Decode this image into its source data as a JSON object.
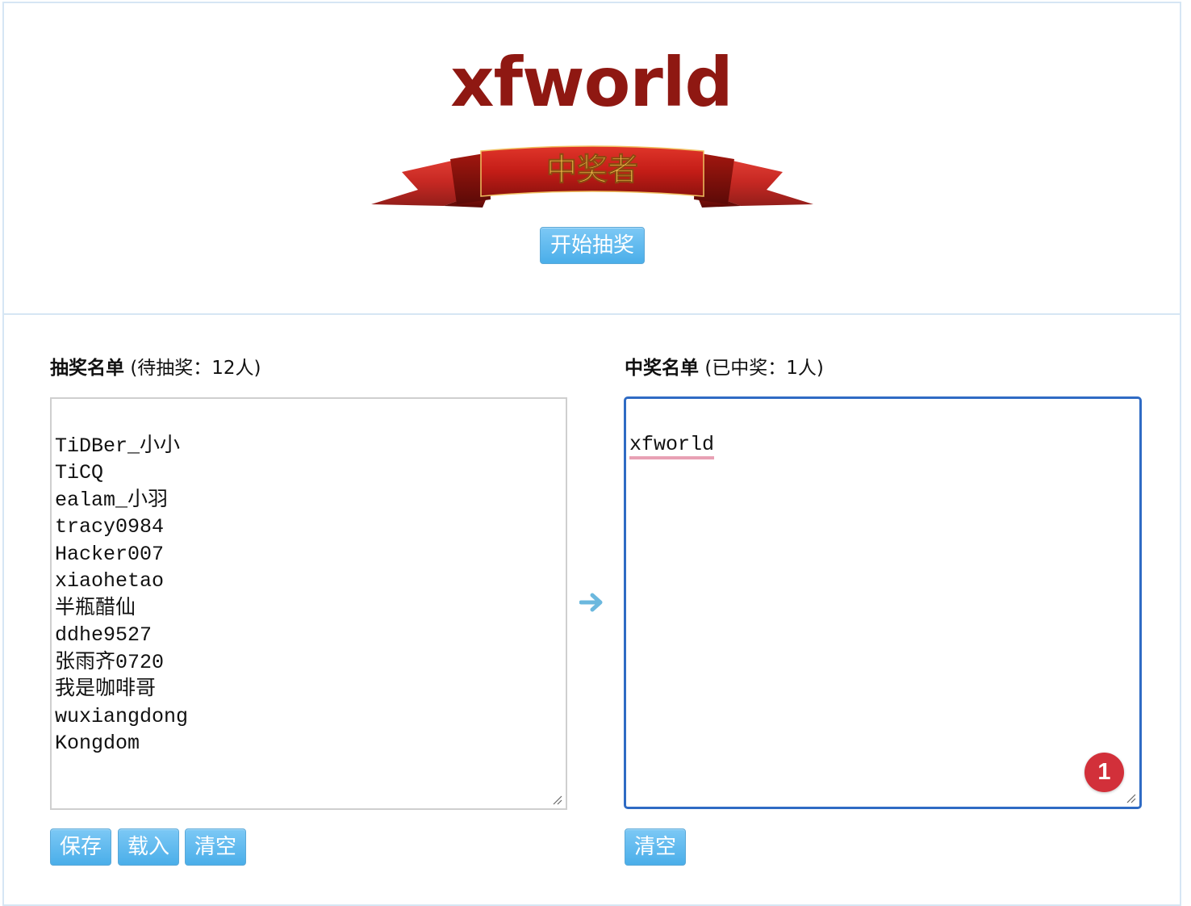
{
  "winner_display": {
    "name": "xfworld",
    "banner_text": "中奖者"
  },
  "controls": {
    "start_label": "开始抽奖"
  },
  "candidates": {
    "title": "抽奖名单",
    "count_text": "(待抽奖：12人)",
    "names": [
      "TiDBer_小小",
      "TiCQ",
      "ealam_小羽",
      "tracy0984",
      "Hacker007",
      "xiaohetao",
      "半瓶醋仙",
      "ddhe9527",
      "张雨齐0720",
      "我是咖啡哥",
      "wuxiangdong",
      "Kongdom"
    ],
    "save_label": "保存",
    "load_label": "载入",
    "clear_label": "清空"
  },
  "winners": {
    "title": "中奖名单",
    "count_text": "(已中奖：1人)",
    "names": [
      "xfworld"
    ],
    "clear_label": "清空",
    "badge_count": "1"
  },
  "colors": {
    "title_red": "#8f1812",
    "button_blue": "#4aaee9",
    "focus_border": "#2f6bc4",
    "badge_red": "#d2303a",
    "ribbon_red": "#c8201a",
    "ribbon_gold": "#f6c851"
  },
  "icons": {
    "transfer": "arrow-right-icon",
    "resize": "resize-grip-icon"
  }
}
